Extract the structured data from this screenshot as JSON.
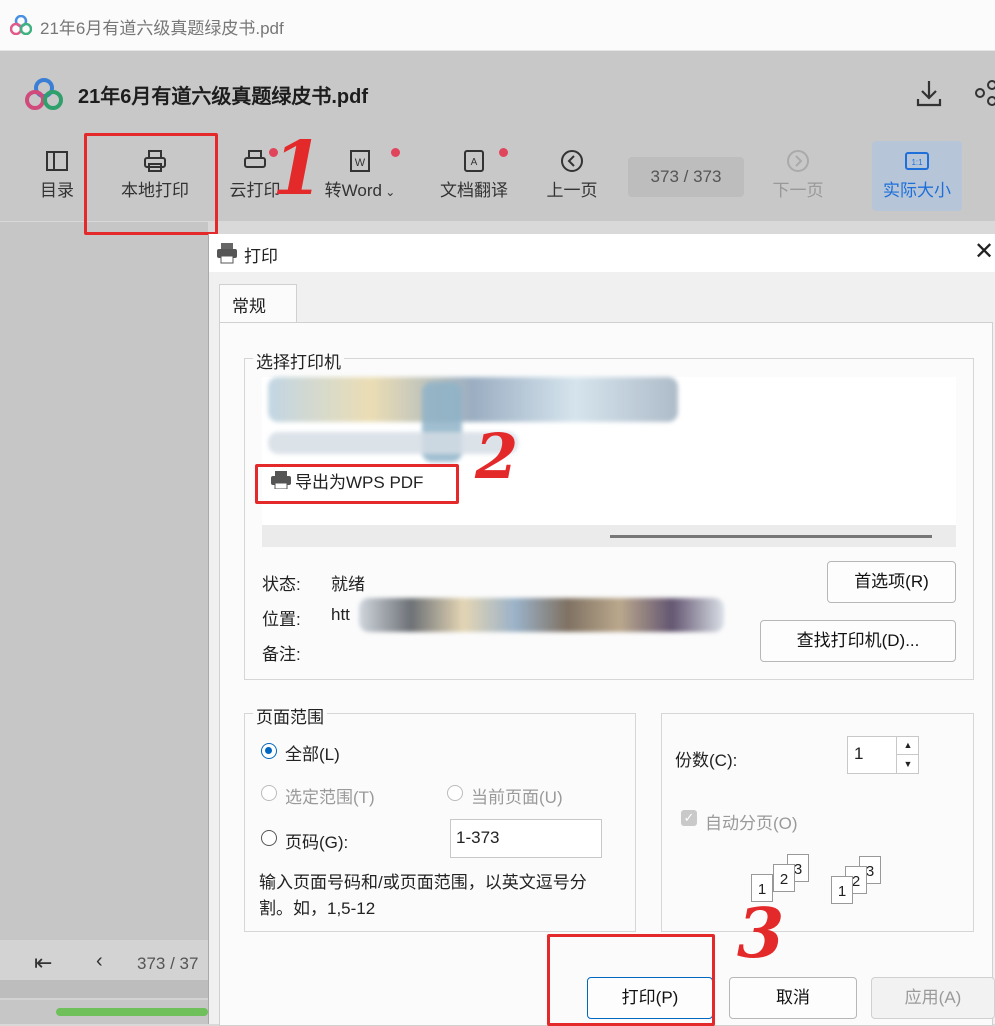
{
  "window": {
    "title": "21年6月有道六级真题绿皮书.pdf"
  },
  "app": {
    "title": "21年6月有道六级真题绿皮书.pdf",
    "toolbar": {
      "toc": "目录",
      "local_print": "本地打印",
      "cloud_print": "云打印",
      "to_word": "转Word",
      "translate": "文档翻译",
      "prev_page": "上一页",
      "page_indicator": "373 / 373",
      "next_page": "下一页",
      "actual_size": "实际大小"
    },
    "bottom_page": "373 / 37"
  },
  "annotations": {
    "step1": "1",
    "step2": "2",
    "step3": "3"
  },
  "dialog": {
    "title": "打印",
    "tab_general": "常规",
    "select_printer_label": "选择打印机",
    "printers": [
      "导出为WPS PDF"
    ],
    "status_label": "状态:",
    "status_value": "就绪",
    "location_label": "位置:",
    "location_prefix": "htt",
    "comment_label": "备注:",
    "preferences_button": "首选项(R)",
    "find_printer_button": "查找打印机(D)...",
    "page_range_label": "页面范围",
    "all": "全部(L)",
    "selection": "选定范围(T)",
    "current_page": "当前页面(U)",
    "pages": "页码(G):",
    "pages_value": "1-373",
    "hint": "输入页面号码和/或页面范围，以英文逗号分割。如，1,5-12",
    "copies_label": "份数(C):",
    "copies_value": "1",
    "collate": "自动分页(O)",
    "collate_pages": [
      "1",
      "2",
      "3"
    ],
    "print_button": "打印(P)",
    "cancel_button": "取消",
    "apply_button": "应用(A)"
  }
}
